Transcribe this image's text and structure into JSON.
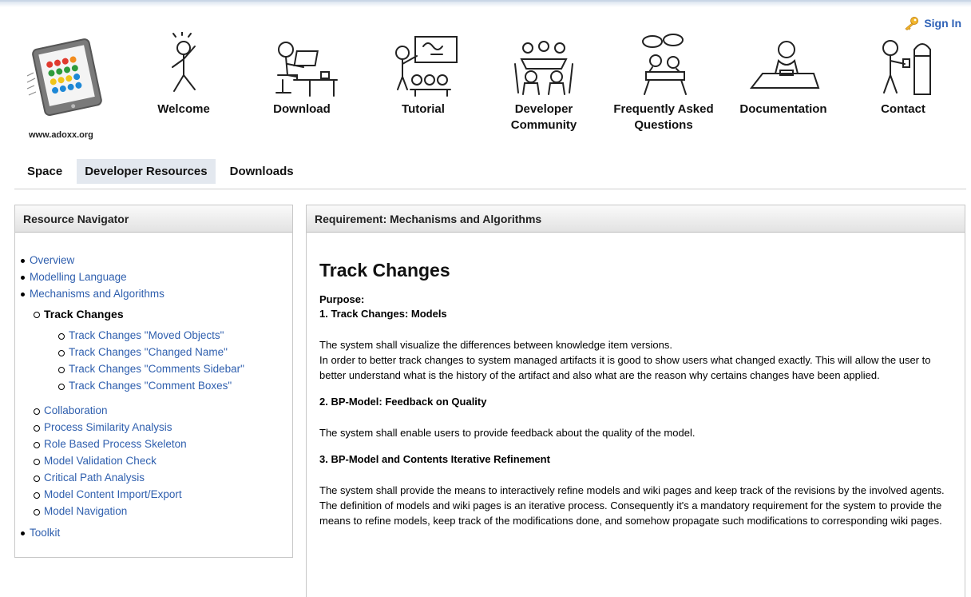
{
  "header": {
    "signin_label": "Sign In",
    "logo_url_text": "www.adoxx.org",
    "nav": [
      {
        "label": "Welcome",
        "icon": "waving-person-icon"
      },
      {
        "label": "Download",
        "icon": "person-at-computer-icon"
      },
      {
        "label": "Tutorial",
        "icon": "classroom-icon"
      },
      {
        "label": "Developer Community",
        "icon": "group-meeting-icon"
      },
      {
        "label": "Frequently Asked Questions",
        "icon": "speech-bubbles-icon"
      },
      {
        "label": "Documentation",
        "icon": "person-writing-icon"
      },
      {
        "label": "Contact",
        "icon": "person-at-mailbox-icon"
      }
    ]
  },
  "subnav": {
    "tabs": [
      "Space",
      "Developer Resources",
      "Downloads"
    ],
    "active": "Developer Resources"
  },
  "left": {
    "title": "Resource Navigator",
    "items": {
      "overview": "Overview",
      "modelling": "Modelling Language",
      "mechanisms": "Mechanisms and Algorithms",
      "track_changes": "Track Changes",
      "tc_moved": "Track Changes \"Moved Objects\"",
      "tc_name": "Track Changes \"Changed Name\"",
      "tc_sidebar": "Track Changes \"Comments Sidebar\"",
      "tc_boxes": "Track Changes \"Comment Boxes\"",
      "collaboration": "Collaboration",
      "similarity": "Process Similarity Analysis",
      "role_based": "Role Based Process Skeleton",
      "validation": "Model Validation Check",
      "critical_path": "Critical Path Analysis",
      "import_export": "Model Content Import/Export",
      "navigation": "Model Navigation",
      "toolkit": "Toolkit"
    }
  },
  "right": {
    "title": "Requirement: Mechanisms and Algorithms",
    "heading": "Track Changes",
    "purpose_label": "Purpose:",
    "sec1_title": "1. Track Changes: Models",
    "sec1_p1": "The system shall visualize the differences between knowledge item versions.",
    "sec1_p2": "In order to better track changes to system managed artifacts it is good to show users what changed exactly. This will allow the user to better understand what is the history of the artifact and also what are the reason why certains changes have been applied.",
    "sec2_title": "2. BP-Model: Feedback on Quality",
    "sec2_p1": "The system shall enable users to provide feedback about the quality of the model.",
    "sec3_title": "3. BP-Model and Contents Iterative Refinement",
    "sec3_p1": "The system shall provide the means to interactively refine models and wiki pages and keep track of the revisions by the involved agents. The definition of models and wiki pages is an iterative process. Consequently it's a mandatory requirement for the system to provide the means to refine models, keep track of the modifications done, and somehow propagate such modifications to corresponding wiki pages."
  },
  "colors": {
    "link": "#2f5fae",
    "signin": "#2f62b7",
    "active_tab_bg": "#e3e8ef"
  }
}
